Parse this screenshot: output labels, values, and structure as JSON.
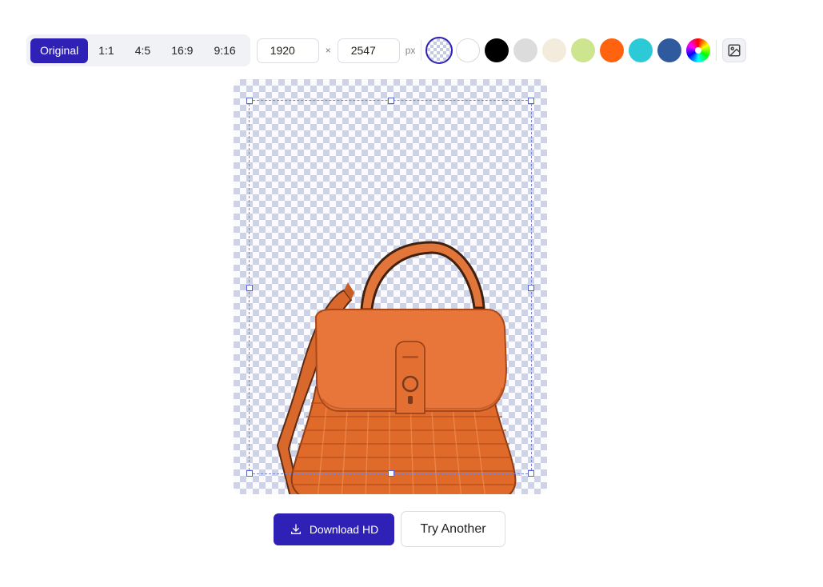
{
  "toolbar": {
    "ratios": [
      "Original",
      "1:1",
      "4:5",
      "16:9",
      "9:16"
    ],
    "active_ratio": "Original",
    "width_value": "1920",
    "height_value": "2547",
    "times_symbol": "×",
    "unit_label": "px",
    "swatches": [
      {
        "name": "transparent",
        "color": "checker",
        "selected": true
      },
      {
        "name": "white",
        "color": "#ffffff"
      },
      {
        "name": "black",
        "color": "#000000"
      },
      {
        "name": "light-gray",
        "color": "#dcdcdc"
      },
      {
        "name": "cream",
        "color": "#f3ecdc"
      },
      {
        "name": "light-green",
        "color": "#cde58e"
      },
      {
        "name": "orange",
        "color": "#ff6310"
      },
      {
        "name": "cyan",
        "color": "#2bcad6"
      },
      {
        "name": "blue",
        "color": "#2f5a9e"
      },
      {
        "name": "custom-color",
        "color": "rainbow"
      }
    ],
    "image_background_icon": "image-icon"
  },
  "canvas": {
    "background": "transparent-checkerboard",
    "subject": "orange-wicker-handbag"
  },
  "actions": {
    "download_label": "Download HD",
    "try_another_label": "Try Another"
  },
  "colors": {
    "accent": "#2f21b5",
    "bag_orange": "#e86f30"
  }
}
